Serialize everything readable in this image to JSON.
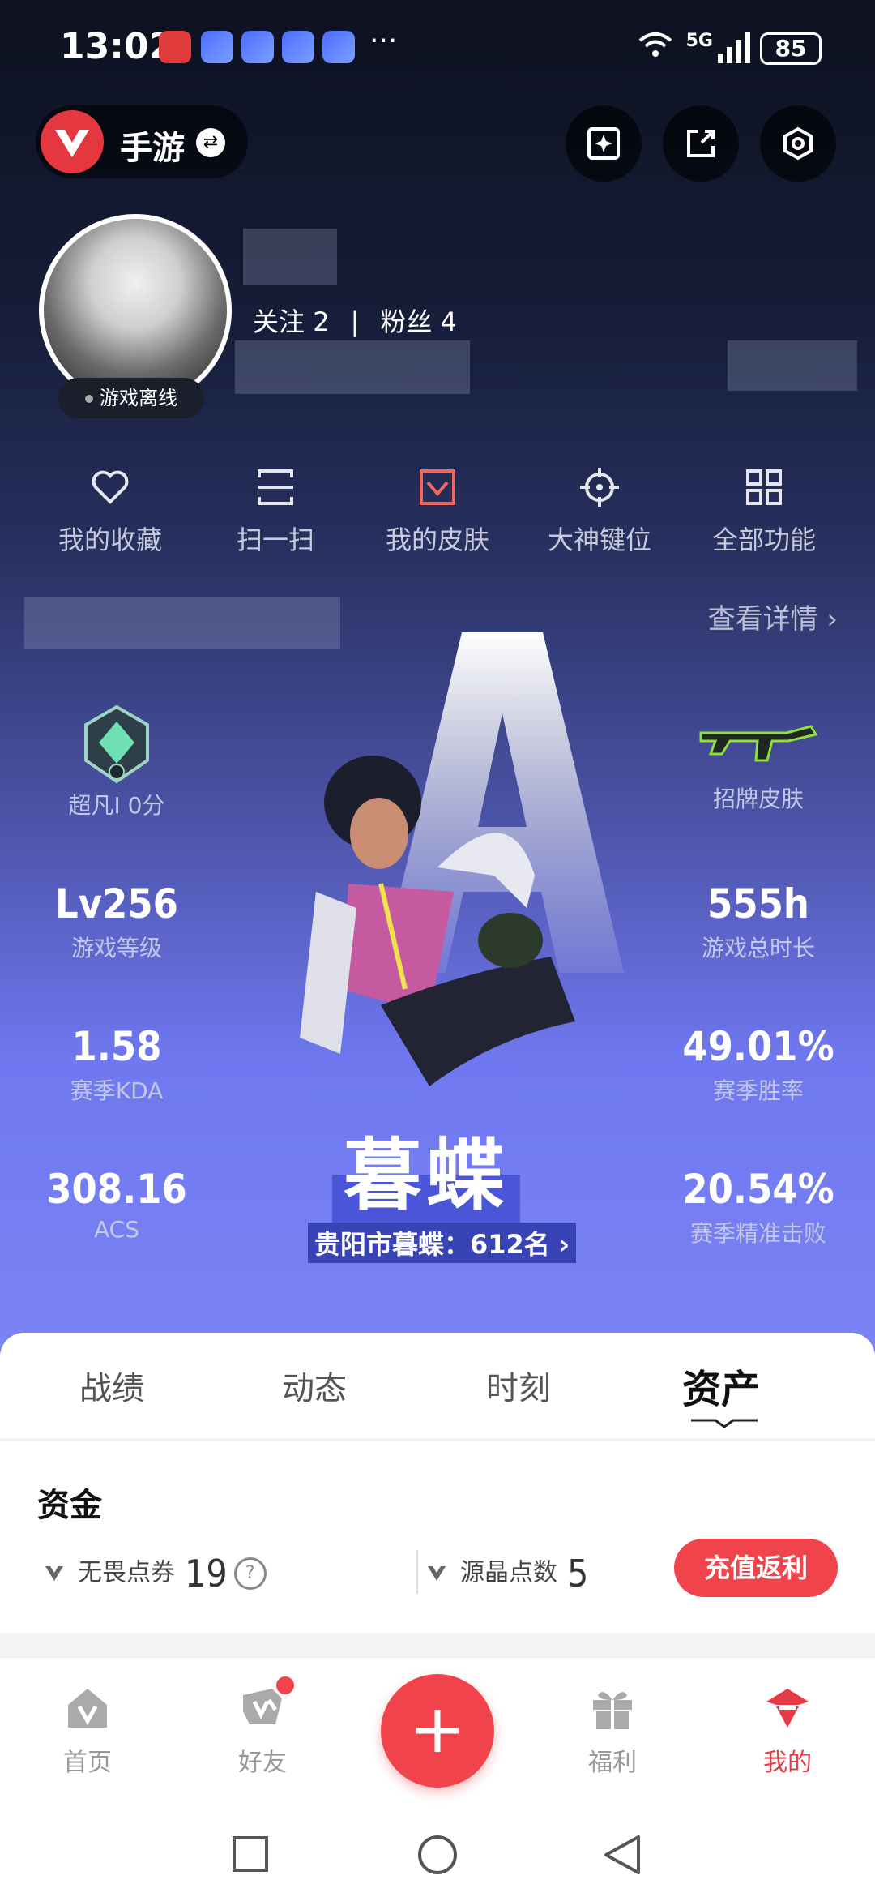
{
  "status_bar": {
    "time": "13:02",
    "network": "5G",
    "battery": "85"
  },
  "header": {
    "game_title": "手游",
    "swap_icon": "swap-icon",
    "actions": [
      "sparkle-card-icon",
      "share-icon",
      "settings-hex-icon"
    ]
  },
  "profile": {
    "follow_label": "关注",
    "follow_count": "2",
    "fans_label": "粉丝",
    "fans_count": "4",
    "status": "游戏离线"
  },
  "quick_actions": [
    {
      "label": "我的收藏",
      "icon": "heart-icon"
    },
    {
      "label": "扫一扫",
      "icon": "scan-icon"
    },
    {
      "label": "我的皮肤",
      "icon": "skin-icon"
    },
    {
      "label": "大神键位",
      "icon": "crosshair-icon"
    },
    {
      "label": "全部功能",
      "icon": "grid-icon"
    }
  ],
  "details_link": "查看详情",
  "stats": {
    "rank": {
      "label": "超凡I 0分"
    },
    "skin": {
      "label": "招牌皮肤"
    },
    "level": {
      "value": "Lv256",
      "label": "游戏等级"
    },
    "hours": {
      "value": "555h",
      "label": "游戏总时长"
    },
    "kda": {
      "value": "1.58",
      "label": "赛季KDA"
    },
    "win_rate": {
      "value": "49.01%",
      "label": "赛季胜率"
    },
    "acs": {
      "value": "308.16",
      "label": "ACS"
    },
    "headshot": {
      "value": "20.54%",
      "label": "赛季精准击败"
    }
  },
  "agent": {
    "name": "暮蝶",
    "rank_text": "贵阳市暮蝶：612名"
  },
  "tabs": [
    {
      "label": "战绩",
      "active": false
    },
    {
      "label": "动态",
      "active": false
    },
    {
      "label": "时刻",
      "active": false
    },
    {
      "label": "资产",
      "active": true
    }
  ],
  "assets": {
    "title": "资金",
    "points_label": "无畏点券",
    "points_value": "19",
    "crystal_label": "源晶点数",
    "crystal_value": "5",
    "recharge_button": "充值返利"
  },
  "bottom_nav": [
    {
      "label": "首页",
      "icon": "home-icon",
      "active": false
    },
    {
      "label": "好友",
      "icon": "friends-icon",
      "active": false,
      "badge": true
    },
    {
      "label": "福利",
      "icon": "gift-icon",
      "active": false
    },
    {
      "label": "我的",
      "icon": "profile-agent-icon",
      "active": true
    }
  ],
  "colors": {
    "accent": "#f0434b",
    "hero_top": "#0d1120",
    "hero_bottom": "#7b84f4"
  }
}
